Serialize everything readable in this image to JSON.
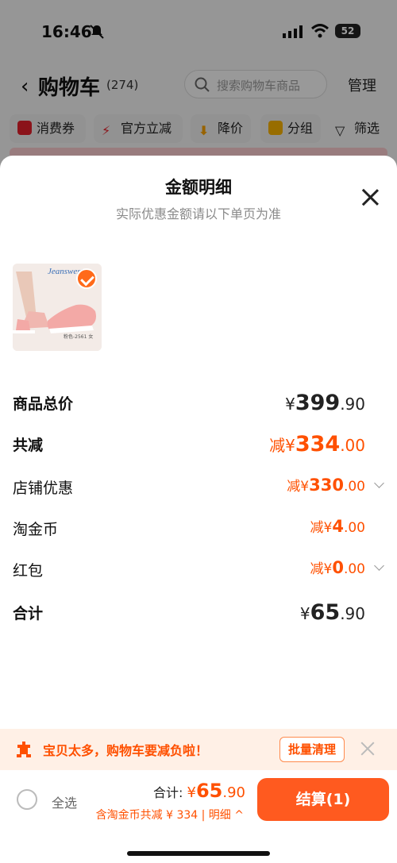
{
  "status_bar": {
    "time": "16:46",
    "battery": "52"
  },
  "nav": {
    "title": "购物车",
    "count": "(274)",
    "search_placeholder": "搜索购物车商品",
    "manage": "管理"
  },
  "filters": [
    {
      "label": "消费券",
      "icon": "coupon-icon"
    },
    {
      "label": "官方立减",
      "icon": "lightning-icon"
    },
    {
      "label": "降价",
      "icon": "price-drop-icon"
    },
    {
      "label": "分组",
      "icon": "folder-icon"
    },
    {
      "label": "筛选",
      "icon": "filter-icon"
    }
  ],
  "sheet": {
    "title": "金额明细",
    "subtitle": "实际优惠金额请以下单页为准",
    "product": {
      "brand": "Jeanswest",
      "caption": "粉色-2561 女"
    },
    "rows": [
      {
        "label": "商品总价",
        "prefix": "",
        "symbol": "¥",
        "int": "399",
        "dec": ".90"
      },
      {
        "label": "共减",
        "prefix": "减",
        "symbol": "¥",
        "int": "334",
        "dec": ".00"
      },
      {
        "label": "店铺优惠",
        "prefix": "减",
        "symbol": "¥",
        "int": "330",
        "dec": ".00"
      },
      {
        "label": "淘金币",
        "prefix": "减",
        "symbol": "¥",
        "int": "4",
        "dec": ".00"
      },
      {
        "label": "红包",
        "prefix": "减",
        "symbol": "¥",
        "int": "0",
        "dec": ".00"
      },
      {
        "label": "合计",
        "prefix": "",
        "symbol": "¥",
        "int": "65",
        "dec": ".90"
      }
    ]
  },
  "notice": {
    "text": "宝贝太多，购物车要减负啦！",
    "button": "批量清理"
  },
  "bottom": {
    "select_all": "全选",
    "total_label": "合计:",
    "total_symbol": "¥",
    "total_int": "65",
    "total_dec": ".90",
    "discount_text": "含淘金币共减 ¥ 334 | 明细",
    "checkout": "结算(1)"
  },
  "colors": {
    "accent": "#ff5000",
    "checkout": "#ff5a1f",
    "notice_bg": "#fff0e6"
  }
}
